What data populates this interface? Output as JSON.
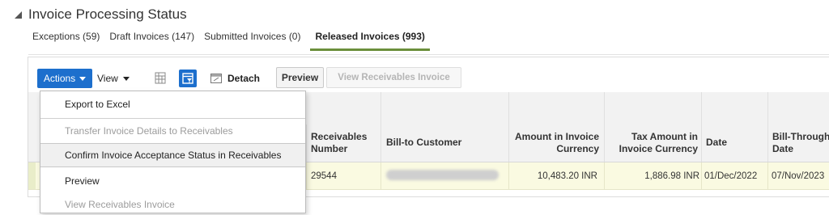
{
  "section": {
    "title": "Invoice Processing Status"
  },
  "tabs": [
    {
      "label": "Exceptions (59)"
    },
    {
      "label": "Draft Invoices (147)"
    },
    {
      "label": "Submitted Invoices (0)"
    },
    {
      "label": "Released Invoices (993)"
    }
  ],
  "active_tab": "Released Invoices (993)",
  "toolbar": {
    "actions_label": "Actions",
    "view_label": "View",
    "detach_label": "Detach",
    "preview_label": "Preview",
    "view_receivables_label": "View Receivables Invoice"
  },
  "actions_menu": {
    "items": [
      {
        "label": "Export to Excel",
        "enabled": true
      },
      {
        "label": "Transfer Invoice Details to Receivables",
        "enabled": false
      },
      {
        "label": "Confirm Invoice Acceptance Status in Receivables",
        "enabled": true
      },
      {
        "label": "Preview",
        "enabled": true
      },
      {
        "label": "View Receivables Invoice",
        "enabled": false
      }
    ]
  },
  "table": {
    "headers": {
      "receivables_number": "Receivables Number",
      "bill_to_customer": "Bill-to Customer",
      "amount_invoice_currency": "Amount in Invoice Currency",
      "tax_amount_invoice_currency": "Tax Amount in Invoice Currency",
      "date": "Date",
      "bill_through_date": "Bill-Through Date"
    },
    "rows": [
      {
        "receivables_number": "29544",
        "bill_to_customer": "",
        "amount_invoice_currency": "10,483.20 INR",
        "tax_amount_invoice_currency": "1,886.98 INR",
        "date": "01/Dec/2022",
        "bill_through_date": "07/Nov/2023"
      }
    ]
  },
  "colors": {
    "accent_blue": "#1d6fcd",
    "active_tab_underline": "#6b8f3b",
    "selected_row": "#fafae1"
  }
}
